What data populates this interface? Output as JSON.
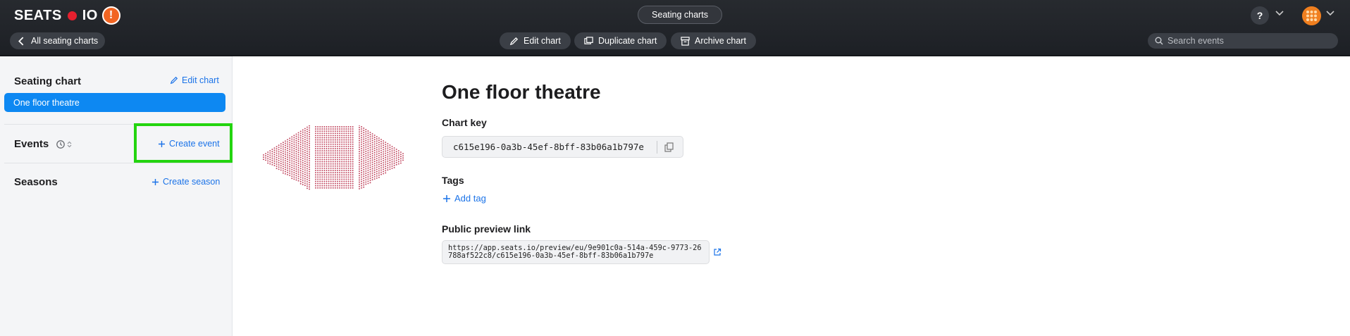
{
  "header": {
    "logo_left": "SEATS",
    "logo_right": "IO",
    "logo_badge": "!",
    "page_title": "Seating charts",
    "back_label": "All seating charts",
    "actions": {
      "edit": "Edit chart",
      "duplicate": "Duplicate chart",
      "archive": "Archive chart"
    },
    "help_label": "?",
    "search_placeholder": "Search events"
  },
  "sidebar": {
    "seating_chart_title": "Seating chart",
    "edit_chart_link": "Edit chart",
    "selected_chart": "One floor theatre",
    "events_title": "Events",
    "create_event_link": "Create event",
    "seasons_title": "Seasons",
    "create_season_link": "Create season"
  },
  "main": {
    "chart_name": "One floor theatre",
    "chart_key_label": "Chart key",
    "chart_key": "c615e196-0a3b-45ef-8bff-83b06a1b797e",
    "tags_label": "Tags",
    "add_tag": "Add tag",
    "public_preview_label": "Public preview link",
    "public_preview_url": "https://app.seats.io/preview/eu/9e901c0a-514a-459c-9773-26788af522c8/c615e196-0a3b-45ef-8bff-83b06a1b797e"
  },
  "colors": {
    "accent": "#0d88f2",
    "link": "#1b73e8",
    "highlight": "#23d40f",
    "seat": "#c0435c"
  }
}
